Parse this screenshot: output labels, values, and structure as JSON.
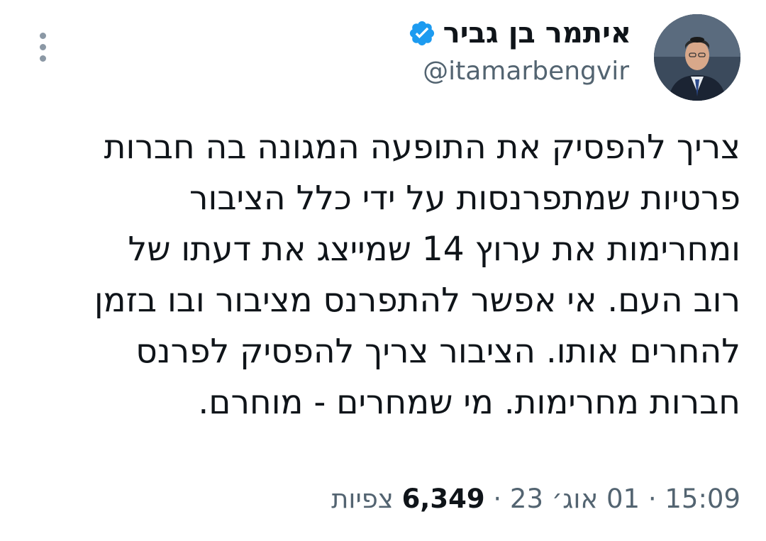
{
  "author": {
    "display_name": "איתמר בן גביר",
    "handle": "@itamarbengvir",
    "verified": true,
    "avatar": "profile-photo",
    "verified_color": "#1d9bf0"
  },
  "tweet": {
    "lines": [
      "צריך להפסיק את התופעה המגונה בה חברות",
      "פרטיות שמתפרנסות על ידי כלל הציבור",
      "ומחרימות את ערוץ 14 שמייצג את דעתו של",
      "רוב העם. אי אפשר להתפרנס מציבור ובו בזמן",
      "להחרים אותו. הציבור צריך להפסיק לפרנס",
      "חברות מחרימות. מי שמחרים - מוחרם."
    ]
  },
  "meta": {
    "time": "15:09",
    "date": "01 אוג׳ 23",
    "views_count": "6,349",
    "views_label": "צפיות",
    "separator": "·"
  },
  "icons": {
    "more": "more-vertical-icon",
    "verified": "verified-badge-icon"
  }
}
